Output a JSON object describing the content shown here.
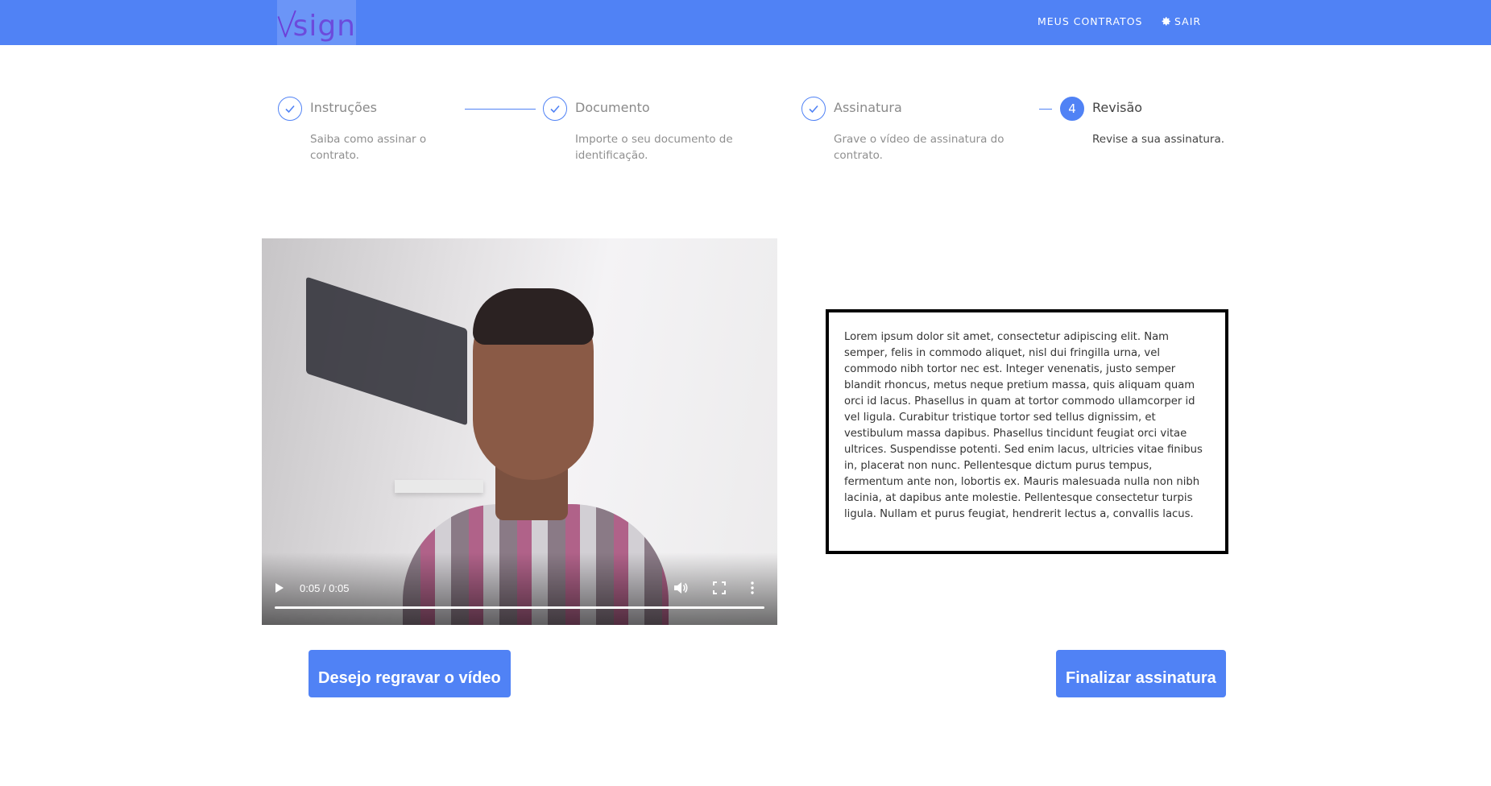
{
  "header": {
    "logo_text": "sign",
    "nav_contracts": "MEUS CONTRATOS",
    "nav_exit": "SAIR"
  },
  "steps": [
    {
      "title": "Instruções",
      "desc": "Saiba como assinar o contrato.",
      "state": "done"
    },
    {
      "title": "Documento",
      "desc": "Importe o seu documento de identificação.",
      "state": "done"
    },
    {
      "title": "Assinatura",
      "desc": "Grave o vídeo de assinatura do contrato.",
      "state": "done"
    },
    {
      "title": "Revisão",
      "desc": "Revise a sua assinatura.",
      "state": "active",
      "number": "4"
    }
  ],
  "video": {
    "time": "0:05 / 0:05",
    "progress_fraction": 1.0
  },
  "text_box": {
    "content": "Lorem ipsum dolor sit amet, consectetur adipiscing elit. Nam semper, felis in commodo aliquet, nisl dui fringilla urna, vel commodo nibh tortor nec est. Integer venenatis, justo semper blandit rhoncus, metus neque pretium massa, quis aliquam quam orci id lacus. Phasellus in quam at tortor commodo ullamcorper id vel ligula. Curabitur tristique tortor sed tellus dignissim, et vestibulum massa dapibus. Phasellus tincidunt feugiat orci vitae ultrices. Suspendisse potenti. Sed enim lacus, ultricies vitae finibus in, placerat non nunc. Pellentesque dictum purus tempus, fermentum ante non, lobortis ex. Mauris malesuada nulla non nibh lacinia, at dapibus ante molestie. Pellentesque consectetur turpis ligula. Nullam et purus feugiat, hendrerit lectus a, convallis lacus."
  },
  "buttons": {
    "rerecord": "Desejo regravar o vídeo",
    "finish": "Finalizar assinatura"
  },
  "colors": {
    "primary": "#5082f5",
    "logo_accent": "#6d3fd8"
  }
}
